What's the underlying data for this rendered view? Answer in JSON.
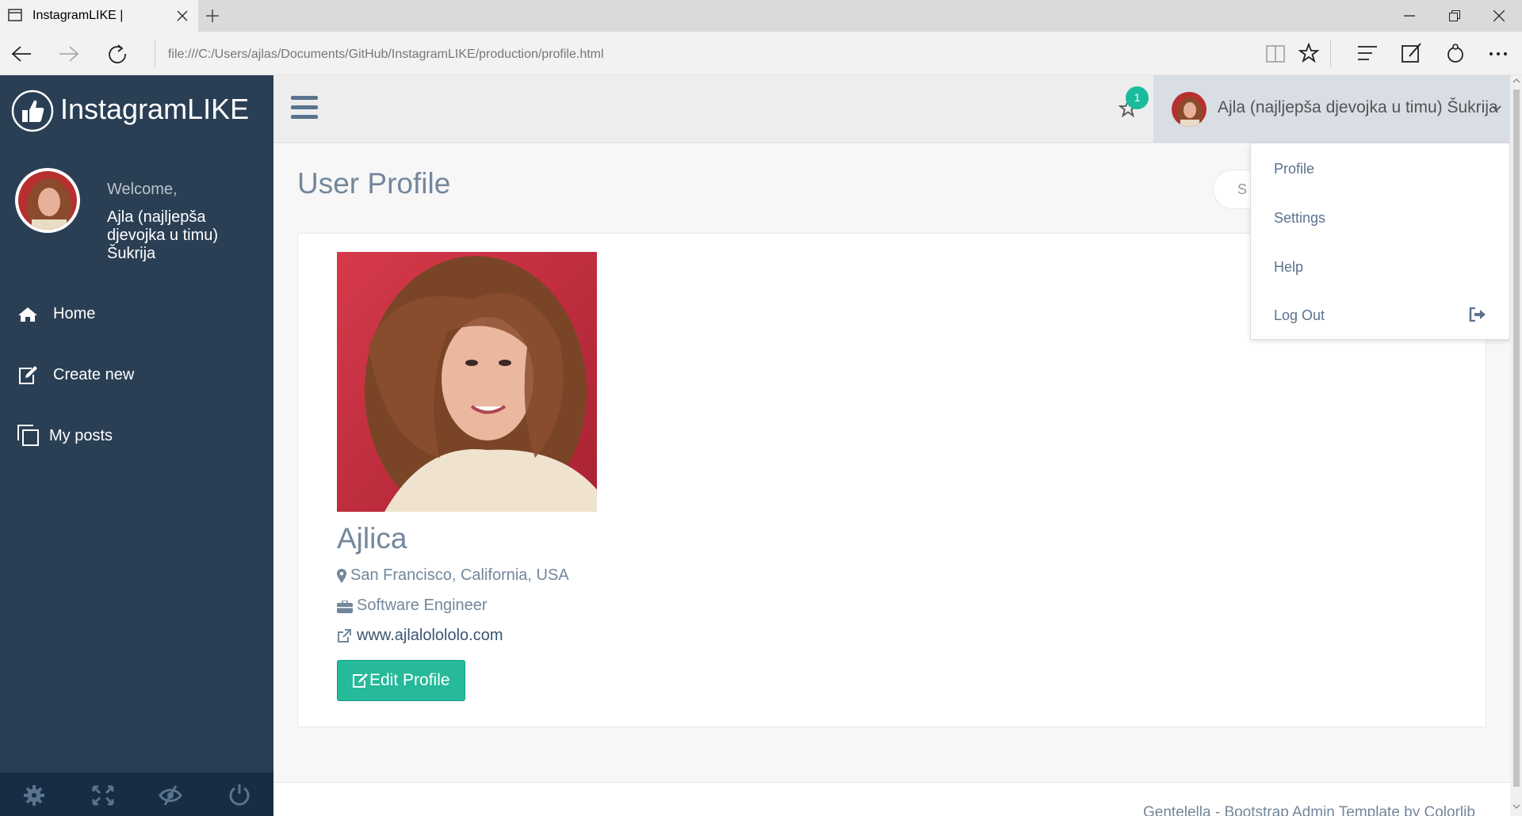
{
  "browser": {
    "tab_title": "InstagramLIKE |",
    "url": "file:///C:/Users/ajlas/Documents/GitHub/InstagramLIKE/production/profile.html"
  },
  "sidebar": {
    "brand": "InstagramLIKE",
    "welcome": "Welcome,",
    "username": "Ajla (najljepša djevojka u timu) Šukrija",
    "nav": [
      {
        "label": "Home",
        "icon": "home-icon"
      },
      {
        "label": "Create new",
        "icon": "edit-icon"
      },
      {
        "label": "My posts",
        "icon": "copy-icon"
      }
    ],
    "footer_icons": [
      "gear-icon",
      "fullscreen-icon",
      "eye-slash-icon",
      "power-icon"
    ]
  },
  "topnav": {
    "notification_count": "1",
    "user_name": "Ajla (najljepša djevojka u timu) Šukrija"
  },
  "dropdown": {
    "items": [
      "Profile",
      "Settings",
      "Help",
      "Log Out"
    ]
  },
  "main": {
    "page_title": "User Profile",
    "search_partial": "S",
    "profile_name": "Ajlica",
    "location": "San Francisco, California, USA",
    "job": "Software Engineer",
    "website": "www.ajlalolololo.com",
    "edit_button": "Edit Profile",
    "footer": "Gentelella - Bootstrap Admin Template by Colorlib"
  },
  "colors": {
    "sidebar": "#2a3f54",
    "accent": "#26b99a",
    "badge": "#1abb9c",
    "text": "#73879c"
  }
}
